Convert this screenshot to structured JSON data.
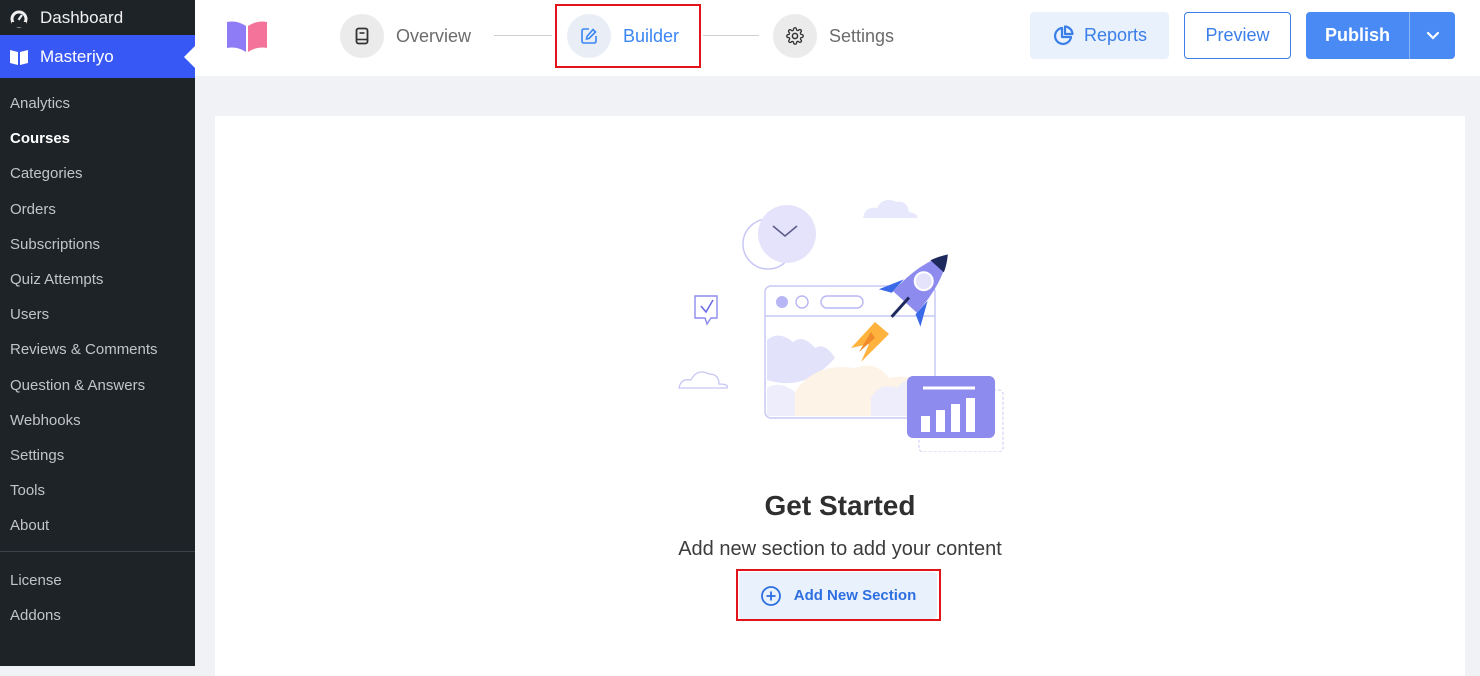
{
  "sidebar": {
    "dashboard_label": "Dashboard",
    "plugin_label": "Masteriyo",
    "items": [
      {
        "label": "Analytics"
      },
      {
        "label": "Courses"
      },
      {
        "label": "Categories"
      },
      {
        "label": "Orders"
      },
      {
        "label": "Subscriptions"
      },
      {
        "label": "Quiz Attempts"
      },
      {
        "label": "Users"
      },
      {
        "label": "Reviews & Comments"
      },
      {
        "label": "Question & Answers"
      },
      {
        "label": "Webhooks"
      },
      {
        "label": "Settings"
      },
      {
        "label": "Tools"
      },
      {
        "label": "About"
      }
    ],
    "bottom_items": [
      {
        "label": "License"
      },
      {
        "label": "Addons"
      }
    ]
  },
  "header": {
    "steps": [
      {
        "label": "Overview",
        "icon": "book-icon"
      },
      {
        "label": "Builder",
        "icon": "edit-icon"
      },
      {
        "label": "Settings",
        "icon": "gear-icon"
      }
    ],
    "reports_label": "Reports",
    "preview_label": "Preview",
    "publish_label": "Publish"
  },
  "main": {
    "title": "Get Started",
    "subtitle": "Add new section to add your content",
    "add_section_label": "Add New Section"
  },
  "colors": {
    "accent": "#3a86f3",
    "highlight": "#e0141a",
    "sidebar_bg": "#1d2327",
    "sidebar_active": "#3858f6"
  }
}
